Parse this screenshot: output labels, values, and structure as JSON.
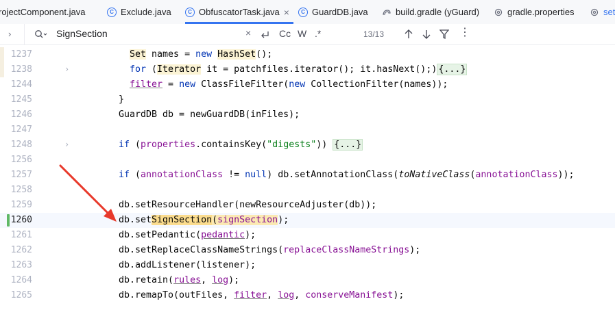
{
  "tabs": [
    {
      "label": "rojectComponent.java",
      "icon": "java-class-icon"
    },
    {
      "label": "Exclude.java",
      "icon": "java-class-icon"
    },
    {
      "label": "ObfuscatorTask.java",
      "icon": "java-class-icon",
      "active": true
    },
    {
      "label": "GuardDB.java",
      "icon": "java-class-icon"
    },
    {
      "label": "build.gradle (yGuard)",
      "icon": "gradle-icon"
    },
    {
      "label": "gradle.properties",
      "icon": "gear-icon"
    },
    {
      "label": "set",
      "icon": "gear-icon"
    }
  ],
  "search": {
    "query": "SignSection",
    "match_count": "13/13",
    "case_label": "Cc",
    "word_label": "W",
    "regex_label": ".*"
  },
  "lines": [
    {
      "num": "1237"
    },
    {
      "num": "1238"
    },
    {
      "num": "1244"
    },
    {
      "num": "1245"
    },
    {
      "num": "1246"
    },
    {
      "num": "1247"
    },
    {
      "num": "1248"
    },
    {
      "num": "1256"
    },
    {
      "num": "1257"
    },
    {
      "num": "1258"
    },
    {
      "num": "1259"
    },
    {
      "num": "1260"
    },
    {
      "num": "1261"
    },
    {
      "num": "1262"
    },
    {
      "num": "1263"
    },
    {
      "num": "1264"
    },
    {
      "num": "1265"
    }
  ],
  "code": {
    "l1237": {
      "t1": "Set",
      "t2": " names = ",
      "t3": "new",
      "t4": " ",
      "t5": "HashSet",
      "t6": "();"
    },
    "l1238": {
      "t1": "for",
      "t2": " (",
      "t3": "Iterator",
      "t4": " it = patchfiles.iterator(); it.hasNext();)",
      "t5": "{...}"
    },
    "l1244": {
      "t1": "filter",
      "t2": " = ",
      "t3": "new",
      "t4": " ClassFileFilter(",
      "t5": "new",
      "t6": " CollectionFilter(names));"
    },
    "l1245": {
      "t1": "}"
    },
    "l1246": {
      "t1": "GuardDB db = newGuardDB(inFiles);"
    },
    "l1248": {
      "t1": "if",
      "t2": " (",
      "t3": "properties",
      "t4": ".containsKey(",
      "t5": "\"digests\"",
      "t6": ")) ",
      "t7": "{...}"
    },
    "l1257": {
      "t1": "if",
      "t2": " (",
      "t3": "annotationClass",
      "t4": " != ",
      "t5": "null",
      "t6": ") db.setAnnotationClass(",
      "t7": "toNativeClass",
      "t8": "(",
      "t9": "annotationClass",
      "t10": "));"
    },
    "l1259": {
      "t1": "db.setResourceHandler(newResourceAdjuster(db));"
    },
    "l1260": {
      "t1": "db.set",
      "t2": "SignSection",
      "t3": "(",
      "t4": "signSection",
      "t5": ");"
    },
    "l1261": {
      "t1": "db.setPedantic(",
      "t2": "pedantic",
      "t3": ");"
    },
    "l1262": {
      "t1": "db.setReplaceClassNameStrings(",
      "t2": "replaceClassNameStrings",
      "t3": ");"
    },
    "l1263": {
      "t1": "db.addListener(listener);"
    },
    "l1264": {
      "t1": "db.retain(",
      "t2": "rules",
      "t3": ", ",
      "t4": "log",
      "t5": ");"
    },
    "l1265": {
      "t1": "db.remapTo(outFiles, ",
      "t2": "filter",
      "t3": ", ",
      "t4": "log",
      "t5": ", ",
      "t6": "conserveManifest",
      "t7": ");"
    }
  },
  "colors": {
    "accent": "#3574f0",
    "search_highlight": "#fbdc8e",
    "annotation_arrow": "#e8392b"
  }
}
